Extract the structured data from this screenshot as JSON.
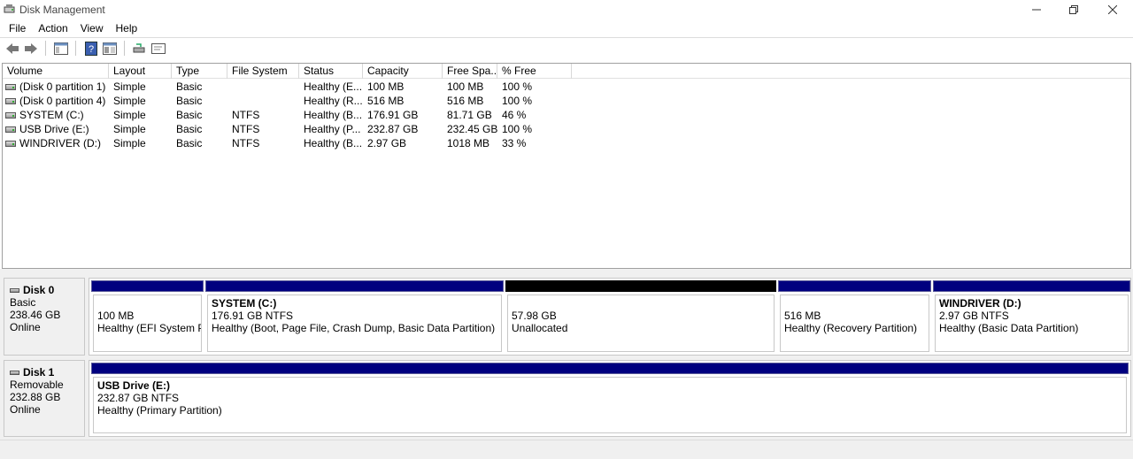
{
  "window": {
    "title": "Disk Management"
  },
  "menu": [
    "File",
    "Action",
    "View",
    "Help"
  ],
  "toolbar": [
    "back-icon",
    "forward-icon",
    "show-hide-tree-icon",
    "help-icon",
    "properties-icon",
    "rescan-disks-icon",
    "console-icon"
  ],
  "volume_list": {
    "columns": [
      "Volume",
      "Layout",
      "Type",
      "File System",
      "Status",
      "Capacity",
      "Free Spa...",
      "% Free"
    ],
    "rows": [
      {
        "volume": "(Disk 0 partition 1)",
        "layout": "Simple",
        "type": "Basic",
        "fs": "",
        "status": "Healthy (E...",
        "capacity": "100 MB",
        "free": "100 MB",
        "pct": "100 %"
      },
      {
        "volume": "(Disk 0 partition 4)",
        "layout": "Simple",
        "type": "Basic",
        "fs": "",
        "status": "Healthy (R...",
        "capacity": "516 MB",
        "free": "516 MB",
        "pct": "100 %"
      },
      {
        "volume": "SYSTEM (C:)",
        "layout": "Simple",
        "type": "Basic",
        "fs": "NTFS",
        "status": "Healthy (B...",
        "capacity": "176.91 GB",
        "free": "81.71 GB",
        "pct": "46 %"
      },
      {
        "volume": "USB Drive (E:)",
        "layout": "Simple",
        "type": "Basic",
        "fs": "NTFS",
        "status": "Healthy (P...",
        "capacity": "232.87 GB",
        "free": "232.45 GB",
        "pct": "100 %"
      },
      {
        "volume": "WINDRIVER (D:)",
        "layout": "Simple",
        "type": "Basic",
        "fs": "NTFS",
        "status": "Healthy (B...",
        "capacity": "2.97 GB",
        "free": "1018 MB",
        "pct": "33 %"
      }
    ]
  },
  "disks": [
    {
      "name": "Disk 0",
      "kind": "Basic",
      "size": "238.46 GB",
      "state": "Online",
      "partitions": [
        {
          "name": "",
          "size": "100 MB",
          "status": "Healthy (EFI System Partition)",
          "unallocated": false
        },
        {
          "name": "SYSTEM  (C:)",
          "size": "176.91 GB NTFS",
          "status": "Healthy (Boot, Page File, Crash Dump, Basic Data Partition)",
          "unallocated": false
        },
        {
          "name": "",
          "size": "57.98 GB",
          "status": "Unallocated",
          "unallocated": true
        },
        {
          "name": "",
          "size": "516 MB",
          "status": "Healthy (Recovery Partition)",
          "unallocated": false
        },
        {
          "name": "WINDRIVER  (D:)",
          "size": "2.97 GB NTFS",
          "status": "Healthy (Basic Data Partition)",
          "unallocated": false
        }
      ]
    },
    {
      "name": "Disk 1",
      "kind": "Removable",
      "size": "232.88 GB",
      "state": "Online",
      "partitions": [
        {
          "name": "USB Drive  (E:)",
          "size": "232.87 GB NTFS",
          "status": "Healthy (Primary Partition)",
          "unallocated": false
        }
      ]
    }
  ],
  "colors": {
    "primary_partition": "#00007f",
    "unallocated": "#000000"
  }
}
